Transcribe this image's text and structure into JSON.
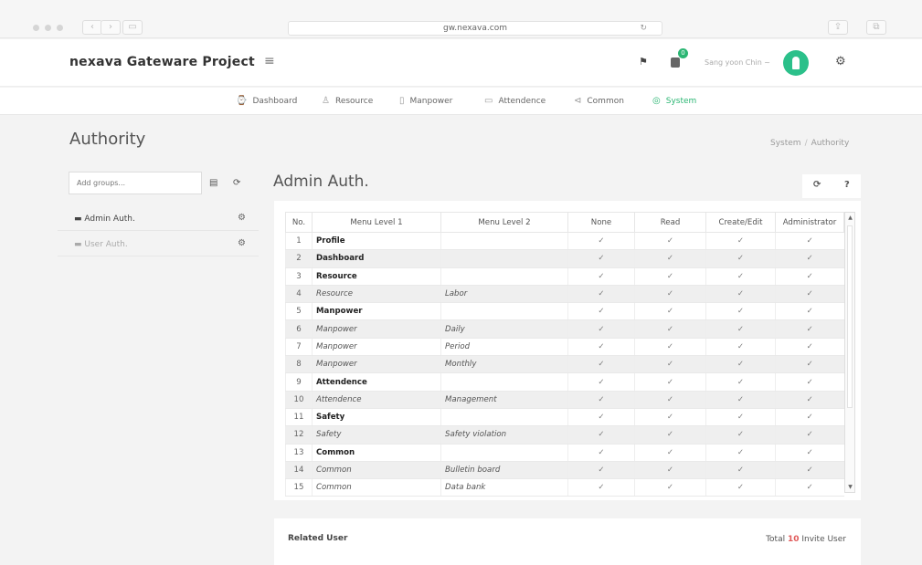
{
  "browser": {
    "url": "gw.nexava.com"
  },
  "header": {
    "brand": "nexava Gateware Project",
    "notification_count": "0",
    "username": "Sang yoon Chin ~"
  },
  "nav": [
    {
      "icon": "⌚",
      "label": "Dashboard"
    },
    {
      "icon": "♙",
      "label": "Resource"
    },
    {
      "icon": "▯",
      "label": "Manpower"
    },
    {
      "icon": "▭",
      "label": "Attendence"
    },
    {
      "icon": "⊲",
      "label": "Common"
    },
    {
      "icon": "◎",
      "label": "System"
    }
  ],
  "page": {
    "title": "Authority",
    "breadcrumb": [
      "System",
      "Authority"
    ]
  },
  "left_panel": {
    "input_placeholder": "Add groups...",
    "groups": [
      {
        "label": "Admin Auth."
      },
      {
        "label": "User Auth."
      }
    ]
  },
  "main": {
    "title": "Admin Auth.",
    "columns": [
      "No.",
      "Menu Level 1",
      "Menu Level 2",
      "None",
      "Read",
      "Create/Edit",
      "Administrator"
    ],
    "rows": [
      {
        "no": "1",
        "m1": "Profile",
        "m2": "",
        "style": "bold"
      },
      {
        "no": "2",
        "m1": "Dashboard",
        "m2": "",
        "style": "bold"
      },
      {
        "no": "3",
        "m1": "Resource",
        "m2": "",
        "style": "bold"
      },
      {
        "no": "4",
        "m1": "Resource",
        "m2": "Labor",
        "style": "italic"
      },
      {
        "no": "5",
        "m1": "Manpower",
        "m2": "",
        "style": "bold"
      },
      {
        "no": "6",
        "m1": "Manpower",
        "m2": "Daily",
        "style": "italic"
      },
      {
        "no": "7",
        "m1": "Manpower",
        "m2": "Period",
        "style": "italic"
      },
      {
        "no": "8",
        "m1": "Manpower",
        "m2": "Monthly",
        "style": "italic"
      },
      {
        "no": "9",
        "m1": "Attendence",
        "m2": "",
        "style": "bold"
      },
      {
        "no": "10",
        "m1": "Attendence",
        "m2": "Management",
        "style": "italic"
      },
      {
        "no": "11",
        "m1": "Safety",
        "m2": "",
        "style": "bold"
      },
      {
        "no": "12",
        "m1": "Safety",
        "m2": "Safety violation",
        "style": "italic"
      },
      {
        "no": "13",
        "m1": "Common",
        "m2": "",
        "style": "bold"
      },
      {
        "no": "14",
        "m1": "Common",
        "m2": "Bulletin board",
        "style": "italic"
      },
      {
        "no": "15",
        "m1": "Common",
        "m2": "Data bank",
        "style": "italic"
      }
    ],
    "check_glyph": "✓"
  },
  "related": {
    "title": "Related User",
    "count_prefix": "Total ",
    "count": "10",
    "count_suffix": " Invite User"
  }
}
